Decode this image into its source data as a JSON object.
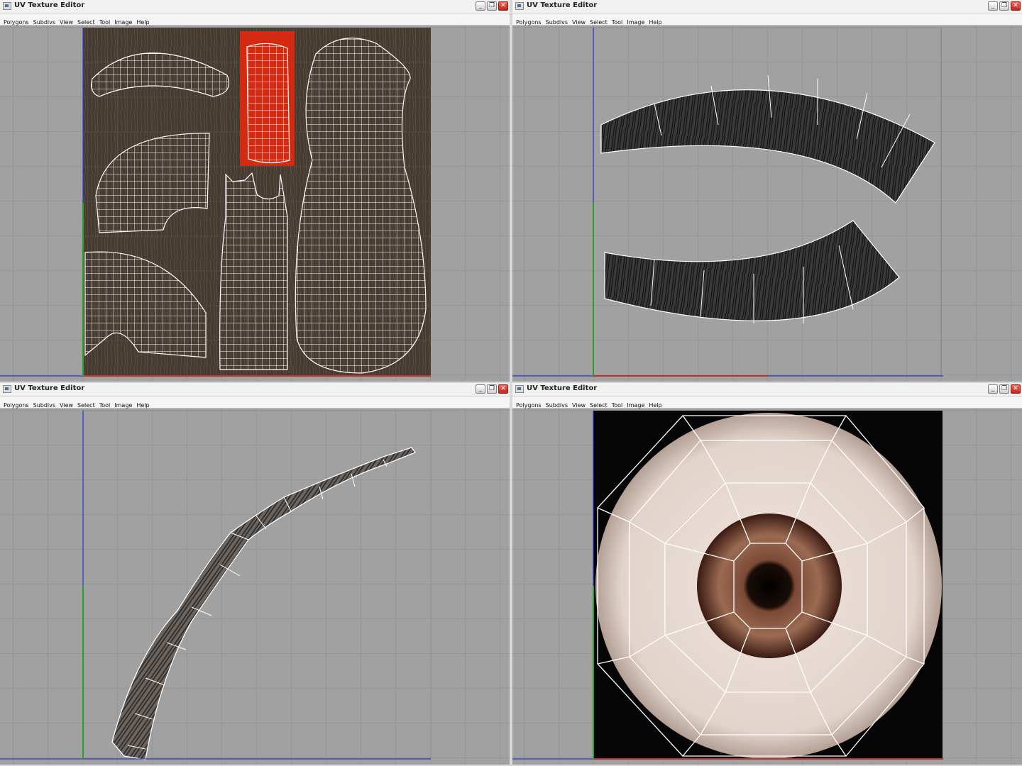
{
  "windows": [
    {
      "title": "UV Texture Editor",
      "menu": [
        "Polygons",
        "Subdivs",
        "View",
        "Select",
        "Tool",
        "Image",
        "Help"
      ]
    },
    {
      "title": "UV Texture Editor",
      "menu": [
        "Polygons",
        "Subdivs",
        "View",
        "Select",
        "Tool",
        "Image",
        "Help"
      ]
    },
    {
      "title": "UV Texture Editor",
      "menu": [
        "Polygons",
        "Subdivs",
        "View",
        "Select",
        "Tool",
        "Image",
        "Help"
      ]
    },
    {
      "title": "UV Texture Editor",
      "menu": [
        "Polygons",
        "Subdivs",
        "View",
        "Select",
        "Tool",
        "Image",
        "Help"
      ]
    }
  ],
  "window_buttons": {
    "minimize": "_",
    "maximize": "❐",
    "close": "✕"
  },
  "colors": {
    "viewport_bg": "#a1a1a1",
    "grid_line": "#8c8c8c",
    "u_axis": "#c03028",
    "v_axis": "#2a3ad0",
    "v_axis_low": "#2aa02a",
    "uv_wire": "#ffffff",
    "selected_shell": "#d52a12",
    "fur_texture": "#4a3e33"
  },
  "icons": {
    "window_icon": "uv-editor-window-icon"
  }
}
